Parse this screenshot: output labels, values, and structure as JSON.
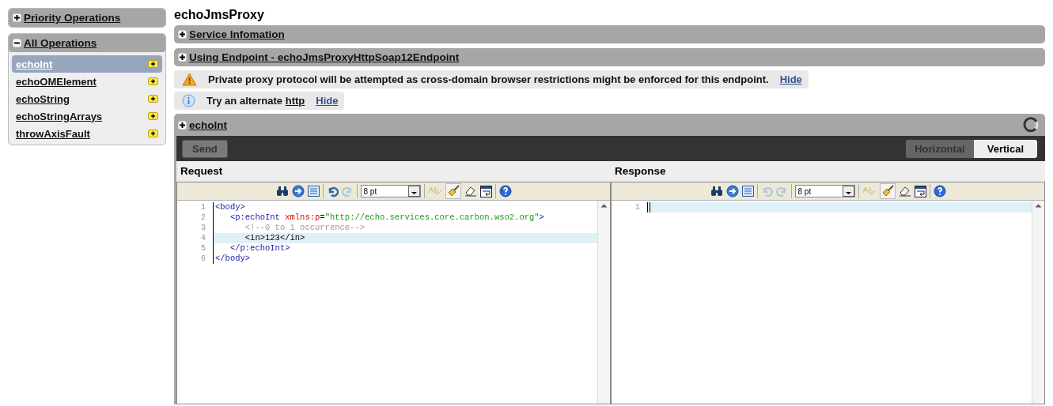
{
  "sidebar": {
    "sections": [
      {
        "title": "Priority Operations",
        "expanded": false
      },
      {
        "title": "All Operations",
        "expanded": true,
        "items": [
          {
            "label": "echoInt",
            "selected": true
          },
          {
            "label": "echoOMElement",
            "selected": false
          },
          {
            "label": "echoString",
            "selected": false
          },
          {
            "label": "echoStringArrays",
            "selected": false
          },
          {
            "label": "throwAxisFault",
            "selected": false
          }
        ]
      }
    ]
  },
  "main": {
    "title": "echoJmsProxy",
    "sections": [
      {
        "title": "Service Infomation",
        "expanded": false
      },
      {
        "title": "Using Endpoint - echoJmsProxyHttpSoap12Endpoint",
        "expanded": false
      }
    ],
    "notices": [
      {
        "kind": "warning",
        "message": "Private proxy protocol will be attempted as cross-domain browser restrictions might be enforced for this endpoint.",
        "hide": "Hide"
      },
      {
        "kind": "info",
        "message": "Try an alternate",
        "link": "http",
        "hide": "Hide"
      }
    ],
    "operation": {
      "title": "echoInt",
      "expanded": true,
      "send": "Send",
      "layouts": [
        {
          "label": "Horizontal",
          "selected": false
        },
        {
          "label": "Vertical",
          "selected": true
        }
      ],
      "editors": [
        {
          "title": "Request",
          "font_size": "8 pt",
          "undo_disabled": false,
          "cursor": false,
          "lines": [
            {
              "number": "1",
              "current": false,
              "tokens": [
                {
                  "kind": "tag",
                  "text": "<body>"
                }
              ]
            },
            {
              "number": "2",
              "current": false,
              "tokens": [
                {
                  "kind": "tag",
                  "text": "   <p:echoInt "
                },
                {
                  "kind": "attr",
                  "text": "xmlns:p"
                },
                {
                  "kind": "text",
                  "text": "="
                },
                {
                  "kind": "string",
                  "text": "\"http://echo.services.core.carbon.wso2.org\""
                },
                {
                  "kind": "tag",
                  "text": ">"
                }
              ]
            },
            {
              "number": "3",
              "current": false,
              "tokens": [
                {
                  "kind": "comment",
                  "text": "      <!--0 to 1 occurrence-->"
                }
              ]
            },
            {
              "number": "4",
              "current": true,
              "tokens": [
                {
                  "kind": "text",
                  "text": "      <in>123</in>"
                }
              ]
            },
            {
              "number": "5",
              "current": false,
              "tokens": [
                {
                  "kind": "tag",
                  "text": "   </p:echoInt>"
                }
              ]
            },
            {
              "number": "6",
              "current": false,
              "tokens": [
                {
                  "kind": "tag",
                  "text": "</body>"
                }
              ]
            }
          ]
        },
        {
          "title": "Response",
          "font_size": "8 pt",
          "undo_disabled": true,
          "cursor": true,
          "lines": [
            {
              "number": "1",
              "current": true
            }
          ]
        }
      ]
    }
  }
}
